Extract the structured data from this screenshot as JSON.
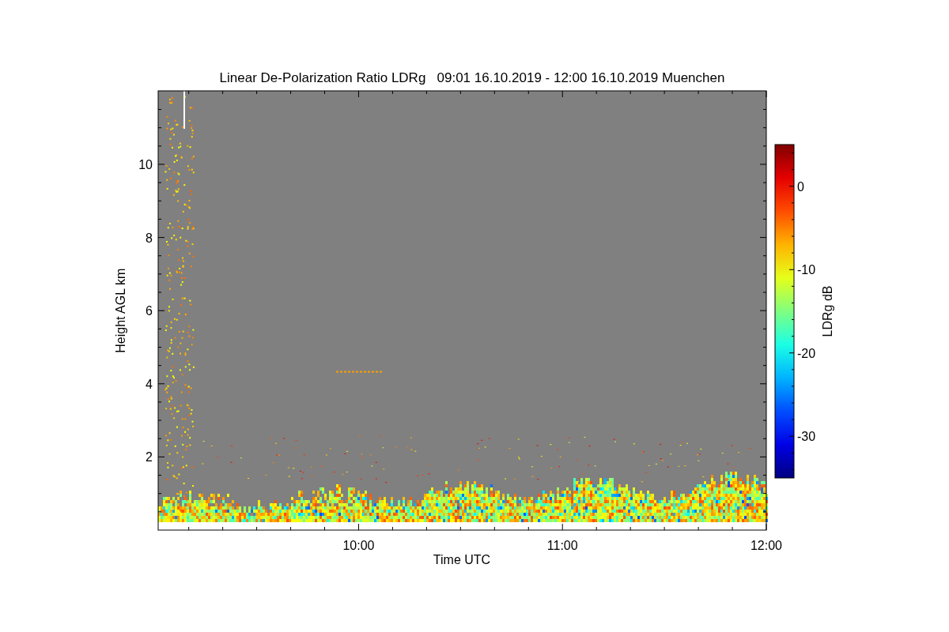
{
  "title": "Linear De-Polarization Ratio LDRg   09:01 16.10.2019 - 12:00 16.10.2019 Muenchen",
  "y_axis": {
    "label": "Height AGL km",
    "ticks": [
      "10",
      "8",
      "6",
      "4",
      "2"
    ]
  },
  "x_axis": {
    "label": "Time UTC",
    "ticks": [
      "10:00",
      "11:00",
      "12:00"
    ]
  },
  "colorbar": {
    "label": "LDRg dB",
    "ticks": [
      "0",
      "-10",
      "-20",
      "-30"
    ]
  }
}
